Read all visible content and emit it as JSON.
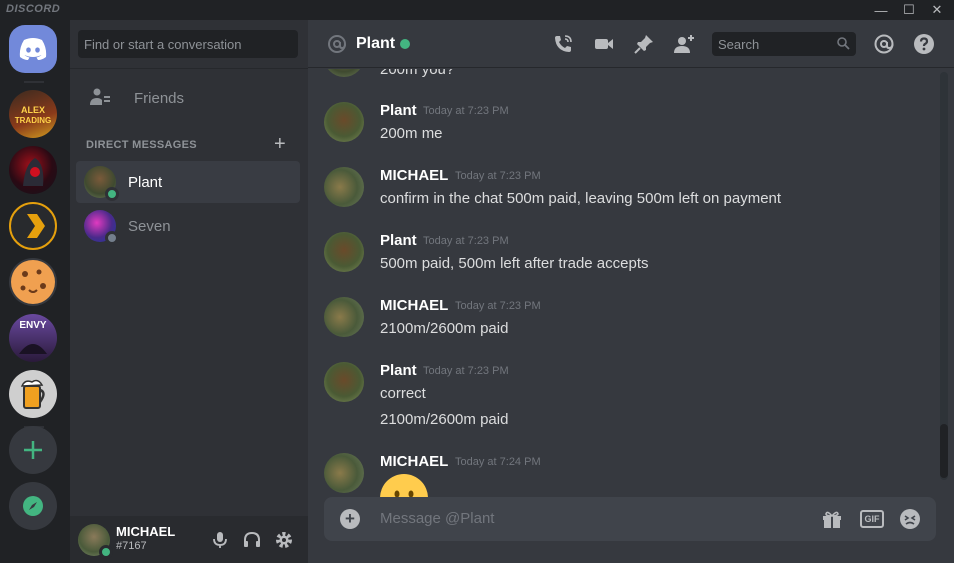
{
  "titlebar": {
    "brand": "DISCORD",
    "minimize": "—",
    "maximize": "☐",
    "close": "✕"
  },
  "servers": [
    "home",
    "alex-trading",
    "dark-server",
    "plex",
    "cookie",
    "envy",
    "beer"
  ],
  "sidebar": {
    "search_placeholder": "Find or start a conversation",
    "friends_label": "Friends",
    "dm_header": "DIRECT MESSAGES",
    "dm_add": "+",
    "dms": [
      {
        "name": "Plant",
        "status": "online",
        "active": true
      },
      {
        "name": "Seven",
        "status": "offline",
        "active": false
      }
    ]
  },
  "user": {
    "name": "MICHAEL",
    "tag": "#7167",
    "status": "online"
  },
  "header": {
    "title": "Plant",
    "search_placeholder": "Search"
  },
  "messages": [
    {
      "author": "",
      "time": "",
      "lines": [
        "200m you?"
      ]
    },
    {
      "author": "Plant",
      "time": "Today at 7:23 PM",
      "lines": [
        "200m me"
      ]
    },
    {
      "author": "MICHAEL",
      "time": "Today at 7:23 PM",
      "lines": [
        "confirm in the chat 500m paid, leaving 500m left on payment"
      ]
    },
    {
      "author": "Plant",
      "time": "Today at 7:23 PM",
      "lines": [
        "500m paid, 500m left after trade accepts"
      ]
    },
    {
      "author": "MICHAEL",
      "time": "Today at 7:23 PM",
      "lines": [
        "2100m/2600m paid"
      ]
    },
    {
      "author": "Plant",
      "time": "Today at 7:23 PM",
      "lines": [
        "correct",
        "2100m/2600m paid"
      ]
    },
    {
      "author": "MICHAEL",
      "time": "Today at 7:24 PM",
      "lines": []
    }
  ],
  "composer": {
    "placeholder": "Message @Plant",
    "gif_label": "GIF"
  },
  "colors": {
    "accent": "#7289da",
    "online": "#43b581",
    "offline": "#747f8d",
    "background": "#36393f"
  }
}
